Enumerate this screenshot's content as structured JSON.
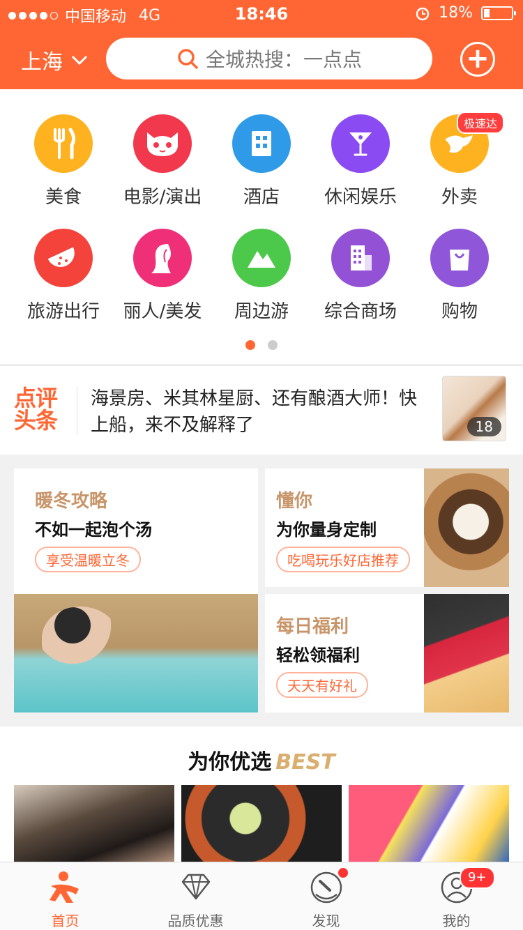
{
  "status_bar": {
    "carrier": "中国移动",
    "network": "4G",
    "time": "18:46",
    "battery": "18%"
  },
  "header": {
    "city": "上海",
    "search_placeholder": "全城热搜：一点点"
  },
  "categories": [
    {
      "label": "美食",
      "icon": "fork-knife-icon",
      "color": "#ffb21f"
    },
    {
      "label": "电影/演出",
      "icon": "cat-icon",
      "color": "#f2384c"
    },
    {
      "label": "酒店",
      "icon": "building-icon",
      "color": "#2f9be8"
    },
    {
      "label": "休闲娱乐",
      "icon": "cocktail-icon",
      "color": "#8b4bf2"
    },
    {
      "label": "外卖",
      "icon": "delivery-icon",
      "color": "#ffb21f",
      "badge": "极速达"
    },
    {
      "label": "旅游出行",
      "icon": "watermelon-icon",
      "color": "#f3433b"
    },
    {
      "label": "丽人/美发",
      "icon": "lady-icon",
      "color": "#ef2f78"
    },
    {
      "label": "周边游",
      "icon": "mountain-icon",
      "color": "#4cc84a"
    },
    {
      "label": "综合商场",
      "icon": "mall-icon",
      "color": "#9352d6"
    },
    {
      "label": "购物",
      "icon": "shopping-bag-icon",
      "color": "#8f56d9"
    }
  ],
  "news": {
    "logo": "点评头条",
    "headline": "海景房、米其林星厨、还有酿酒大师！快上船，来不及解释了",
    "image_count": "18"
  },
  "promos": {
    "winter": {
      "title": "暖冬攻略",
      "subtitle": "不如一起泡个汤",
      "tag": "享受温暖立冬"
    },
    "know": {
      "title": "懂你",
      "subtitle": "为你量身定制",
      "tag": "吃喝玩乐好店推荐"
    },
    "daily": {
      "title": "每日福利",
      "subtitle": "轻松领福利",
      "tag": "天天有好礼"
    }
  },
  "best": {
    "title": "为你优选",
    "en": "BEST"
  },
  "tabbar": {
    "items": [
      {
        "label": "首页",
        "icon": "home-icon"
      },
      {
        "label": "品质优惠",
        "icon": "diamond-icon"
      },
      {
        "label": "发现",
        "icon": "compass-icon"
      },
      {
        "label": "我的",
        "icon": "user-icon",
        "badge": "9+"
      }
    ]
  },
  "colors": {
    "brand": "#ff6633",
    "gold": "#c8956a"
  }
}
